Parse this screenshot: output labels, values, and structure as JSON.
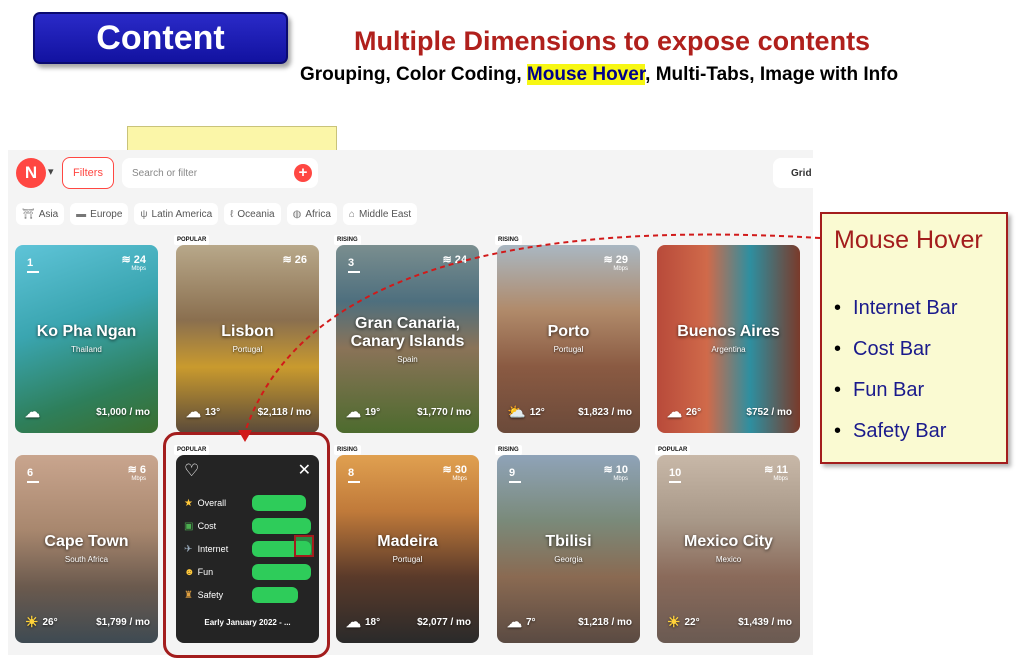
{
  "header": {
    "badge": "Content",
    "headline": "Multiple Dimensions to expose contents",
    "subline_before": "Grouping, Color Coding, ",
    "subline_highlight": "Mouse Hover",
    "subline_after": ", Multi-Tabs, Image with Info"
  },
  "app": {
    "logo_letter": "N",
    "filters_label": "Filters",
    "search_placeholder": "Search or filter",
    "grid_label": "Grid",
    "regions": [
      {
        "label": "Asia",
        "icon": "pagoda-icon"
      },
      {
        "label": "Europe",
        "icon": "flag-icon"
      },
      {
        "label": "Latin America",
        "icon": "cactus-icon"
      },
      {
        "label": "Oceania",
        "icon": "kangaroo-icon"
      },
      {
        "label": "Africa",
        "icon": "globe-icon"
      },
      {
        "label": "Middle East",
        "icon": "mosque-icon"
      }
    ],
    "cards": [
      {
        "rank": "1",
        "wifi": "24",
        "wifi_unit": "Mbps",
        "city": "Ko Pha Ngan",
        "country": "Thailand",
        "tag": "",
        "temp": "",
        "cost": "$1,000 / mo"
      },
      {
        "rank": "",
        "wifi": "26",
        "wifi_unit": "",
        "city": "Lisbon",
        "country": "Portugal",
        "tag": "POPULAR",
        "temp": "13°",
        "cost": "$2,118 / mo"
      },
      {
        "rank": "3",
        "wifi": "24",
        "wifi_unit": "",
        "city": "Gran Canaria, Canary Islands",
        "country": "Spain",
        "tag": "RISING",
        "temp": "19°",
        "cost": "$1,770 / mo"
      },
      {
        "rank": "",
        "wifi": "29",
        "wifi_unit": "Mbps",
        "city": "Porto",
        "country": "Portugal",
        "tag": "RISING",
        "temp": "12°",
        "cost": "$1,823 / mo"
      },
      {
        "rank": "",
        "wifi": "",
        "wifi_unit": "",
        "city": "Buenos Aires",
        "country": "Argentina",
        "tag": "",
        "temp": "26°",
        "cost": "$752 / mo"
      },
      {
        "rank": "6",
        "wifi": "6",
        "wifi_unit": "Mbps",
        "city": "Cape Town",
        "country": "South Africa",
        "tag": "",
        "temp": "26°",
        "cost": "$1,799 / mo"
      },
      {
        "rank": "8",
        "wifi": "30",
        "wifi_unit": "Mbps",
        "city": "Madeira",
        "country": "Portugal",
        "tag": "RISING",
        "temp": "18°",
        "cost": "$2,077 / mo"
      },
      {
        "rank": "9",
        "wifi": "10",
        "wifi_unit": "Mbps",
        "city": "Tbilisi",
        "country": "Georgia",
        "tag": "RISING",
        "temp": "7°",
        "cost": "$1,218 / mo"
      },
      {
        "rank": "10",
        "wifi": "11",
        "wifi_unit": "Mbps",
        "city": "Mexico City",
        "country": "Mexico",
        "tag": "POPULAR",
        "temp": "22°",
        "cost": "$1,439 / mo"
      }
    ],
    "hover_card": {
      "tag": "POPULAR",
      "bars": [
        {
          "label": "Overall",
          "icon": "star-icon",
          "level": 0.92
        },
        {
          "label": "Cost",
          "icon": "money-icon",
          "level": 1.0
        },
        {
          "label": "Internet",
          "icon": "satellite-icon",
          "level": 1.0
        },
        {
          "label": "Fun",
          "icon": "smile-icon",
          "level": 1.0
        },
        {
          "label": "Safety",
          "icon": "police-icon",
          "level": 0.78
        }
      ],
      "period": "Early January 2022 - ..."
    }
  },
  "callout": {
    "title": "Mouse Hover",
    "items": [
      "Internet Bar",
      "Cost Bar",
      "Fun Bar",
      "Safety Bar"
    ]
  },
  "colors": {
    "accent": "#ff4742",
    "callout_border": "#a31d1d",
    "bar_green": "#2ecc5a",
    "headline_red": "#b0201c"
  }
}
